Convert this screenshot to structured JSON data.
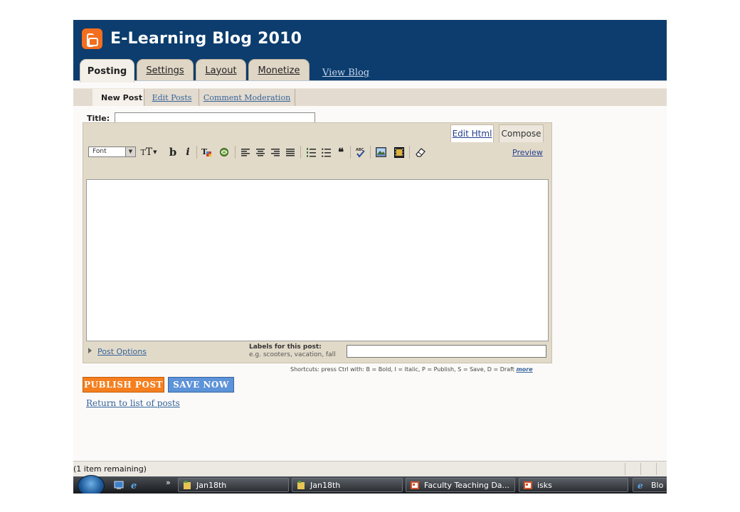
{
  "header": {
    "blog_title": "E-Learning Blog 2010",
    "tabs": [
      {
        "label": "Posting",
        "active": true
      },
      {
        "label": "Settings"
      },
      {
        "label": "Layout"
      },
      {
        "label": "Monetize"
      }
    ],
    "view_blog": "View Blog"
  },
  "subnav": {
    "items": [
      {
        "label": "New Post",
        "active": true
      },
      {
        "label": "Edit Posts"
      },
      {
        "label": "Comment Moderation"
      }
    ]
  },
  "post": {
    "title_label": "Title:",
    "title_value": ""
  },
  "editor": {
    "modes": [
      "Edit Html",
      "Compose"
    ],
    "active_mode": "Compose",
    "font_select": "Font",
    "toolbar_glyphs": {
      "font_size": "T",
      "bold": "b",
      "italic": "i"
    },
    "preview": "Preview",
    "content": ""
  },
  "post_options": {
    "label": "Post Options",
    "labels_title": "Labels for this post:",
    "labels_hint": "e.g. scooters, vacation, fall",
    "labels_value": ""
  },
  "shortcuts": {
    "text": "Shortcuts: press Ctrl with: B = Bold, I = Italic, P = Publish, S = Save, D = Draft",
    "more": "more"
  },
  "actions": {
    "publish": "PUBLISH POST",
    "save": "SAVE NOW",
    "return": "Return to list of posts"
  },
  "status_bar": {
    "text": "(1 item remaining)"
  },
  "taskbar": {
    "overflow": "»",
    "tasks": [
      {
        "label": "Jan18th",
        "icon": "folder-icon"
      },
      {
        "label": "Jan18th",
        "icon": "folder-icon"
      },
      {
        "label": "Faculty Teaching Da...",
        "icon": "powerpoint-icon"
      },
      {
        "label": "isks",
        "icon": "powerpoint-icon"
      },
      {
        "label": "Blo",
        "icon": "ie-icon"
      }
    ]
  },
  "colors": {
    "header_bg": "#0c3d6e",
    "tab_bg": "#e0d6c6",
    "publish_btn": "#f57f1f",
    "save_btn": "#5d93d8",
    "link": "#35639a"
  }
}
